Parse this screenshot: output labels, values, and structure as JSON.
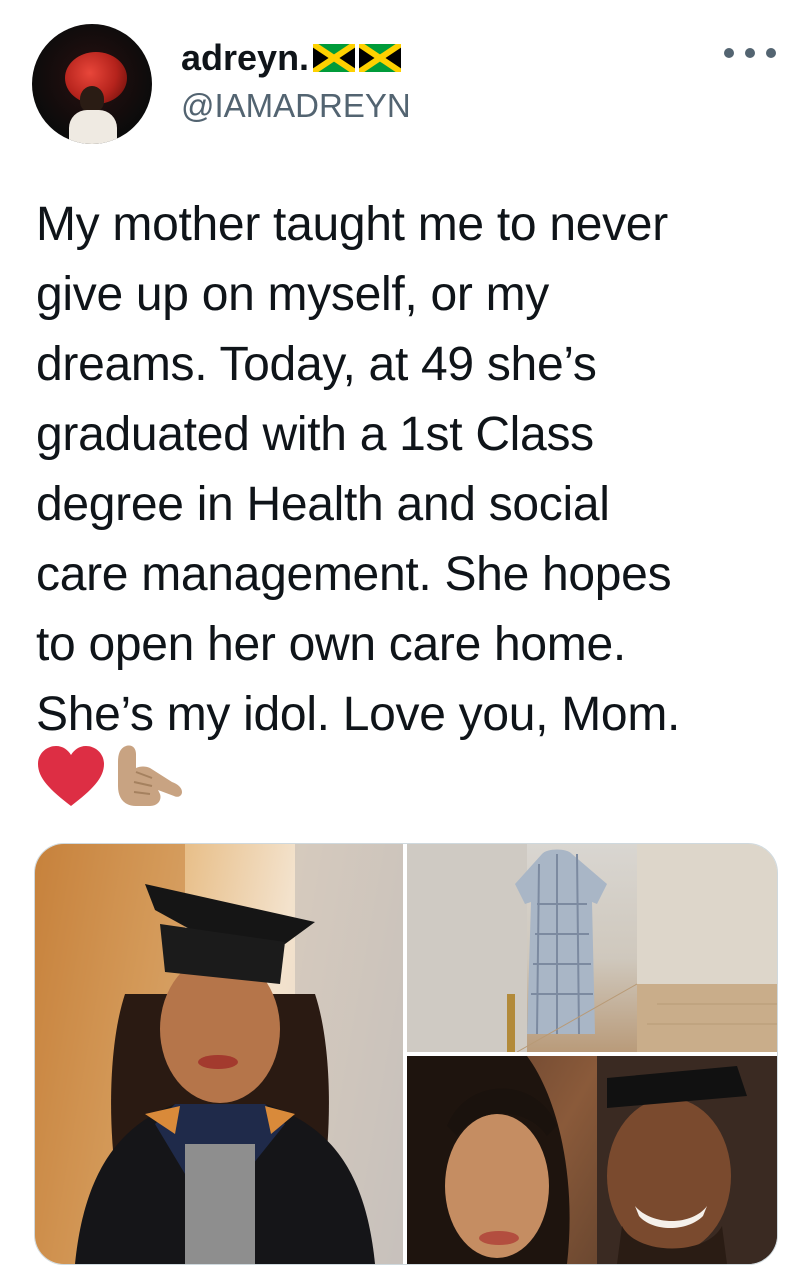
{
  "user": {
    "display_name": "adreyn.",
    "handle": "@IAMADREYN",
    "flags": [
      "jamaica-flag-icon",
      "jamaica-flag-icon"
    ]
  },
  "menu": {
    "icon": "more-options-icon"
  },
  "tweet": {
    "text": "My mother taught me to never\ngive up on myself, or my\ndreams. Today, at 49 she’s\ngraduated with a 1st Class\ndegree in Health and social\ncare management. She hopes\nto open her own care home.\nShe’s my idol. Love you, Mom.",
    "emojis": [
      "red-heart-icon",
      "call-me-hand-icon"
    ]
  },
  "media": {
    "photos": [
      "graduation-portrait-photo",
      "dress-full-length-photo",
      "selfie-photo"
    ]
  },
  "colors": {
    "text": "#0f1419",
    "secondary": "#536471",
    "border": "#cfd9de",
    "heart": "#dd2e44"
  }
}
